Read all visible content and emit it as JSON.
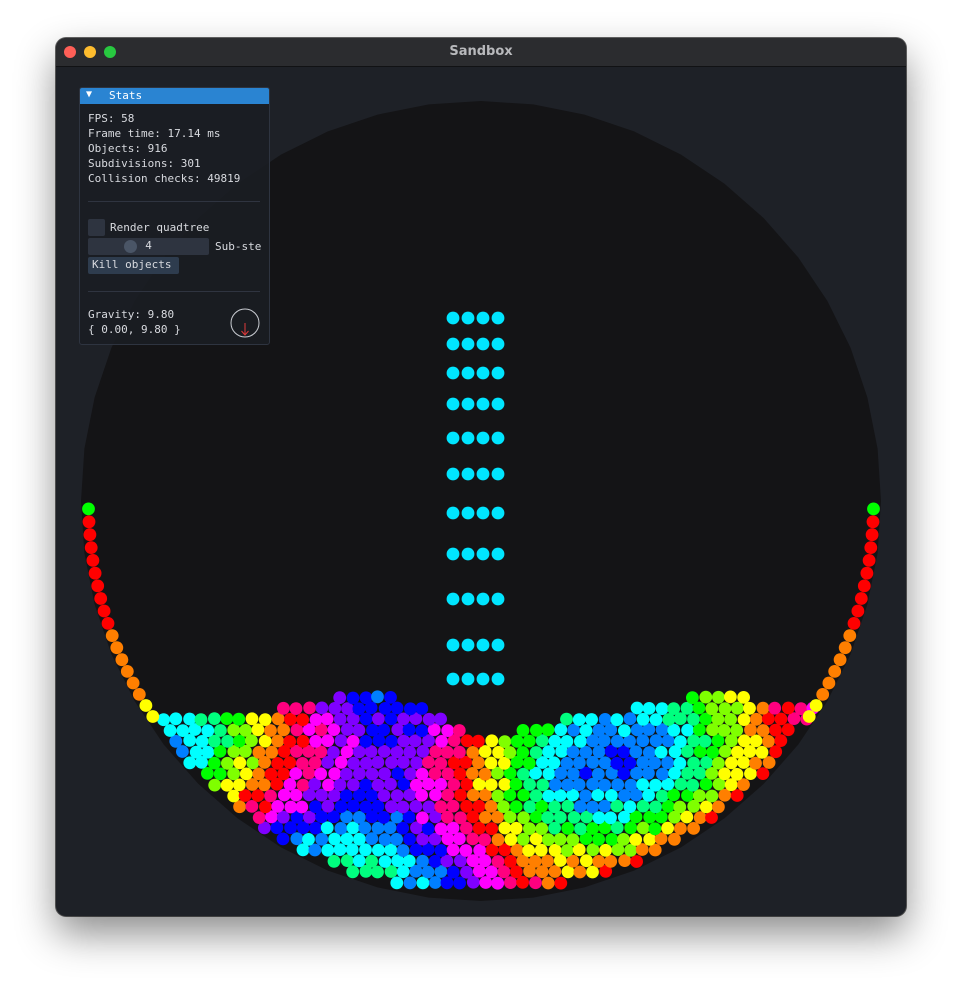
{
  "window": {
    "title": "Sandbox"
  },
  "stats_panel": {
    "header": "Stats",
    "fps": "FPS: 58",
    "frame_time": "Frame time: 17.14 ms",
    "objects": "Objects: 916",
    "subdivisions": "Subdivisions: 301",
    "collision_checks": "Collision checks: 49819",
    "render_quadtree_label": "Render quadtree",
    "render_quadtree_checked": false,
    "sub_steps_value": "4",
    "sub_steps_label": "Sub-ste",
    "kill_objects_label": "Kill objects",
    "gravity": "Gravity: 9.80",
    "gravity_vector": "{ 0.00, 9.80 }",
    "gravity_direction_icon": "arrow-down-icon"
  },
  "simulation": {
    "container_color": "#141416",
    "background_color": "#1e2127",
    "stream_color": "#00e5ff",
    "palette": [
      "#ff0000",
      "#ff7f00",
      "#ffff00",
      "#7fff00",
      "#00ff00",
      "#00ff7f",
      "#00ffff",
      "#007fff",
      "#0000ff",
      "#7f00ff",
      "#ff00ff",
      "#ff007f"
    ]
  }
}
